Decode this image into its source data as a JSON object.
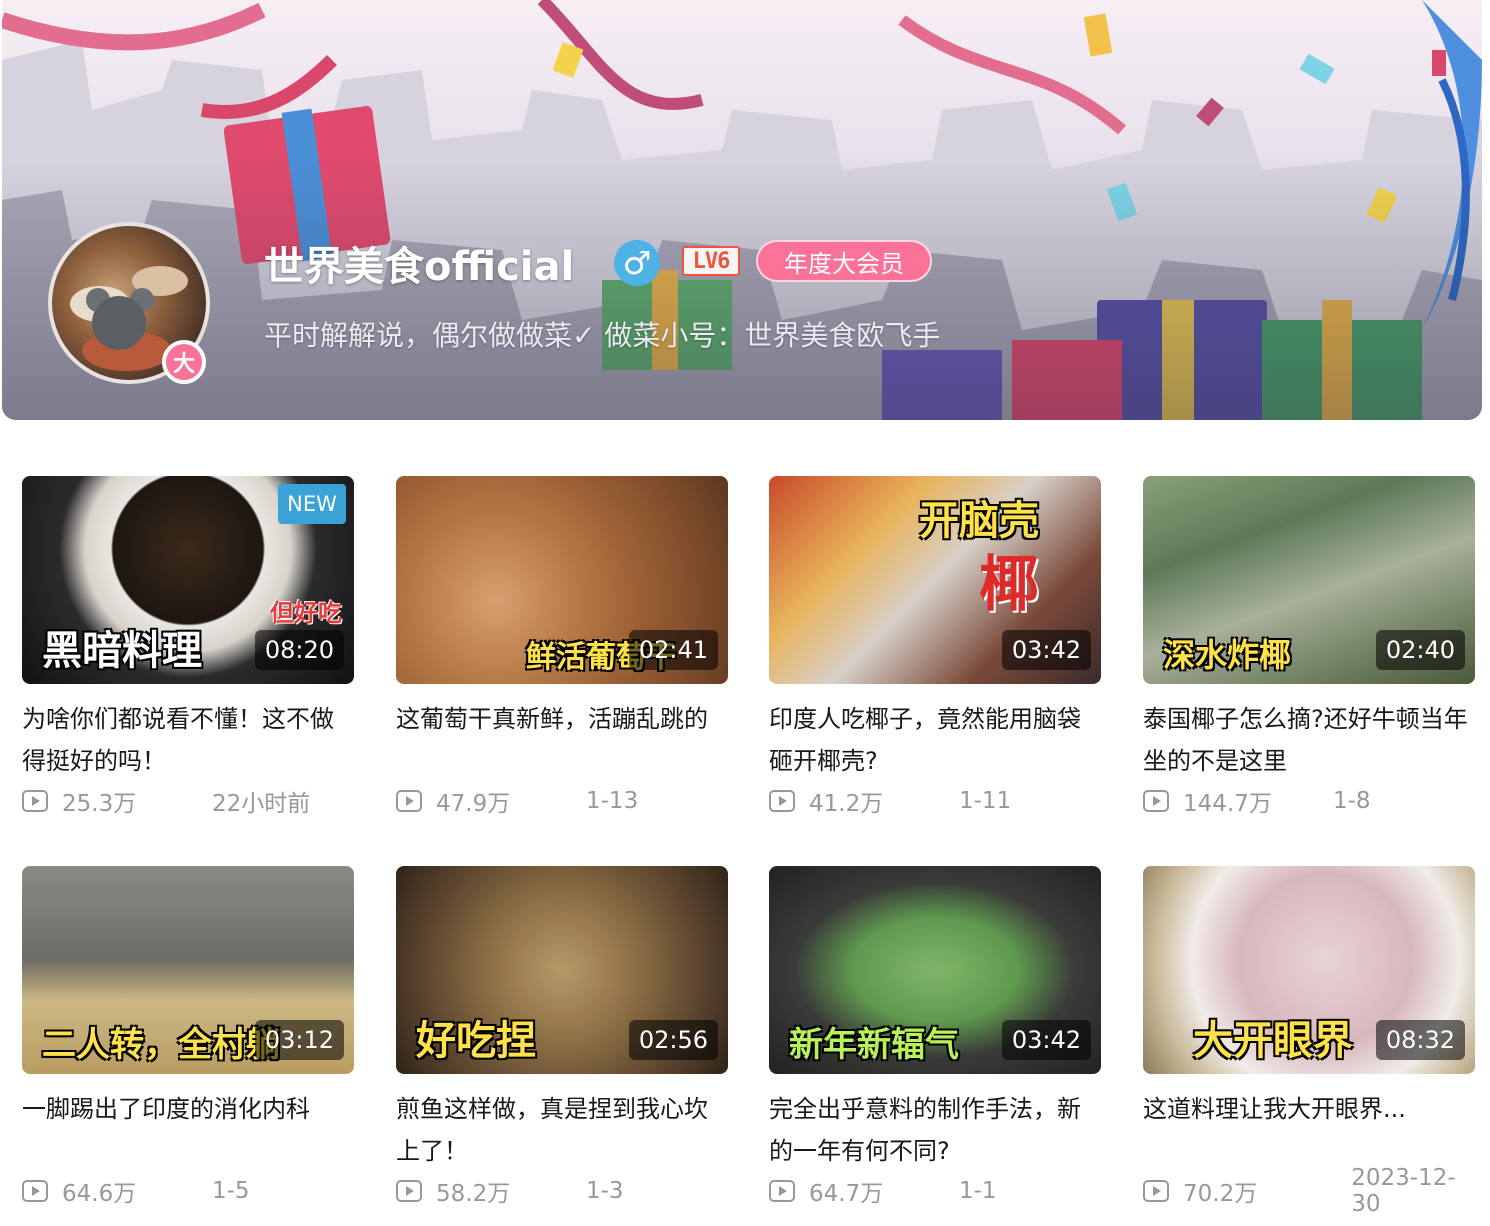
{
  "profile": {
    "username": "世界美食official",
    "gender_symbol": "♂",
    "level": "LV6",
    "vip_badge": "年度大会员",
    "avatar_badge": "大",
    "signature": "平时解解说，偶尔做做菜✓ 做菜小号：世界美食欧飞手"
  },
  "videos": [
    {
      "title": "为啥你们都说看不懂！这不做得挺好的吗！",
      "views": "25.3万",
      "date": "22小时前",
      "duration": "08:20",
      "overlay": "黑暗料理",
      "overlay_tag": "但好吃",
      "new_badge": "NEW"
    },
    {
      "title": "这葡萄干真新鲜，活蹦乱跳的",
      "views": "47.9万",
      "date": "1-13",
      "duration": "02:41",
      "overlay": "鲜活葡萄干"
    },
    {
      "title": "印度人吃椰子，竟然能用脑袋砸开椰壳?",
      "views": "41.2万",
      "date": "1-11",
      "duration": "03:42",
      "overlay": "开脑壳",
      "overlay_tag": "椰"
    },
    {
      "title": "泰国椰子怎么摘?还好牛顿当年坐的不是这里",
      "views": "144.7万",
      "date": "1-8",
      "duration": "02:40",
      "overlay": "深水炸椰"
    },
    {
      "title": "一脚踢出了印度的消化内科",
      "views": "64.6万",
      "date": "1-5",
      "duration": "03:12",
      "overlay": "二人转，全村躺"
    },
    {
      "title": "煎鱼这样做，真是捏到我心坎上了！",
      "views": "58.2万",
      "date": "1-3",
      "duration": "02:56",
      "overlay": "好吃捏"
    },
    {
      "title": "完全出乎意料的制作手法，新的一年有何不同?",
      "views": "64.7万",
      "date": "1-1",
      "duration": "03:42",
      "overlay": "新年新辐气"
    },
    {
      "title": "这道料理让我大开眼界...",
      "views": "70.2万",
      "date": "2023-12-30",
      "duration": "08:32",
      "overlay": "大开眼界"
    }
  ],
  "colors": {
    "accent_pink": "#fb7299",
    "meta_gray": "#9499a0",
    "new_blue": "#3aa2d6"
  }
}
